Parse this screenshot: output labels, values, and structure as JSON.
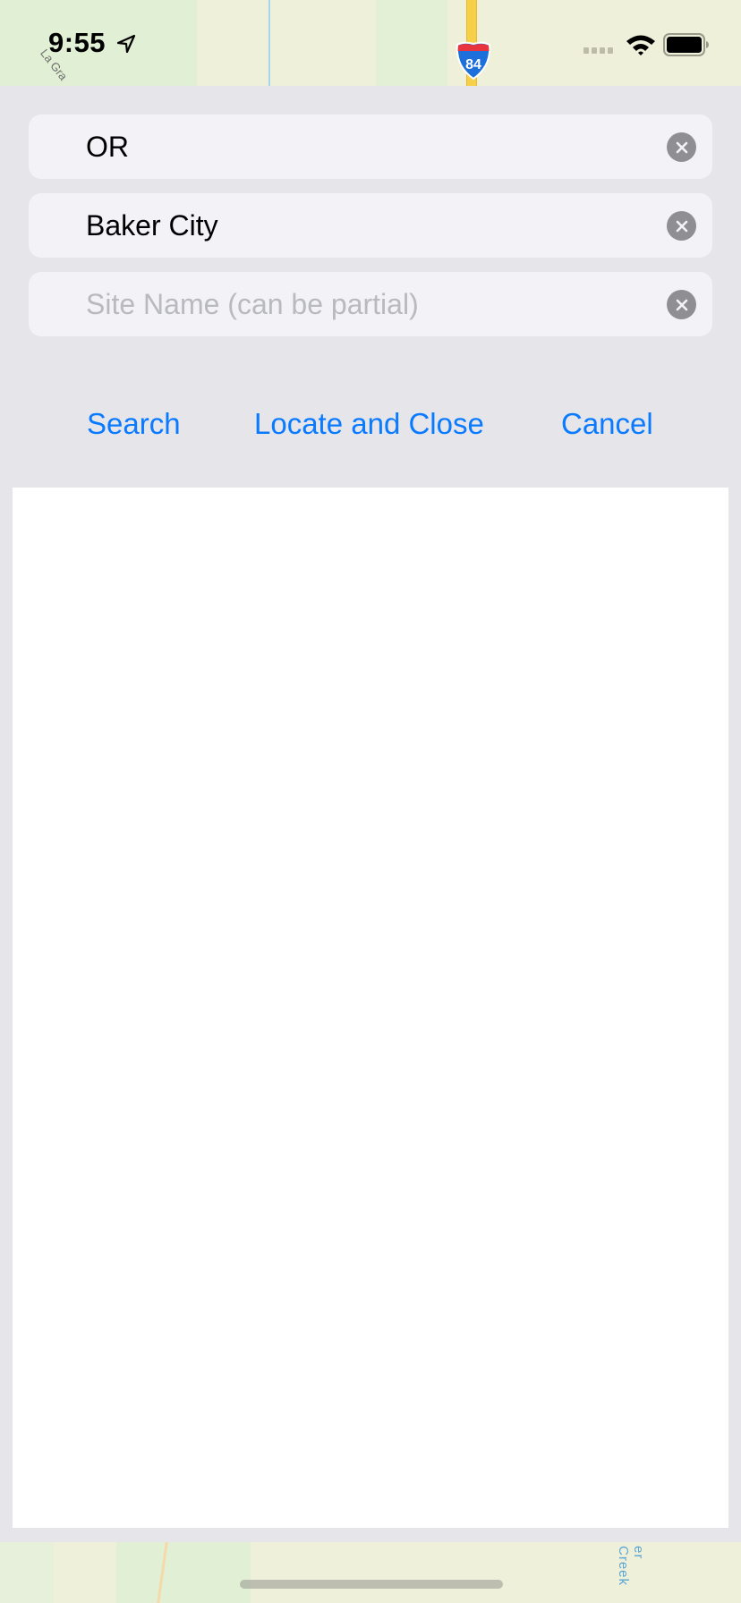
{
  "status_bar": {
    "time": "9:55",
    "location_icon": "location-arrow-icon",
    "signal_icon": "cellular-signal-icon",
    "wifi_icon": "wifi-icon",
    "battery_icon": "battery-full-icon"
  },
  "map": {
    "road_shield_label": "84",
    "road_label": "La Gra",
    "creek_label": "er Creek"
  },
  "form": {
    "fields": [
      {
        "value": "OR",
        "placeholder": ""
      },
      {
        "value": "Baker City",
        "placeholder": ""
      },
      {
        "value": "",
        "placeholder": "Site Name (can be partial)"
      }
    ],
    "clear_icon": "clear-circle-x-icon"
  },
  "actions": {
    "search_label": "Search",
    "locate_label": "Locate and Close",
    "cancel_label": "Cancel"
  },
  "results": [],
  "colors": {
    "accent": "#0a7aff",
    "sheet_background": "#e5e5ea",
    "field_background": "#f2f2f7",
    "clear_button": "#8e8e93"
  }
}
